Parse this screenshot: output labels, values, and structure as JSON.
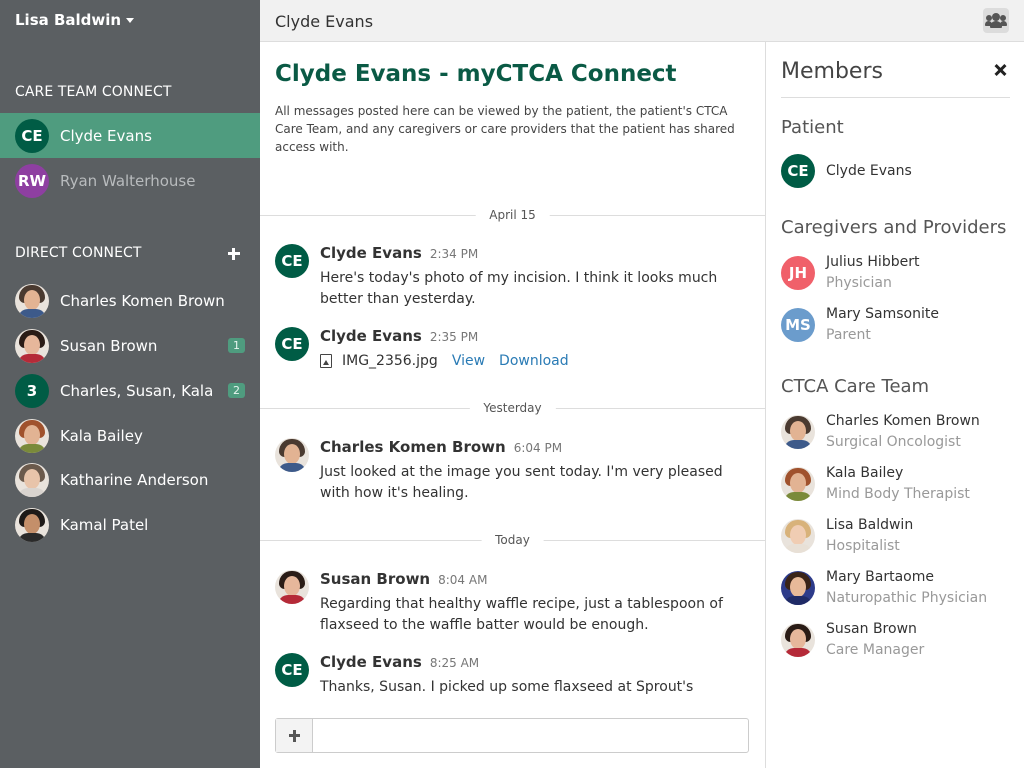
{
  "sidebar": {
    "user_name": "Lisa Baldwin",
    "care_team_header": "CARE TEAM CONNECT",
    "direct_header": "DIRECT CONNECT",
    "care_team": [
      {
        "initials": "CE",
        "label": "Clyde Evans"
      },
      {
        "initials": "RW",
        "label": "Ryan Walterhouse"
      }
    ],
    "direct": [
      {
        "label": "Charles Komen Brown",
        "badge": ""
      },
      {
        "label": "Susan Brown",
        "badge": "1"
      },
      {
        "initials": "3",
        "label": "Charles, Susan, Kala",
        "badge": "2"
      },
      {
        "label": "Kala Bailey",
        "badge": ""
      },
      {
        "label": "Katharine Anderson",
        "badge": ""
      },
      {
        "label": "Kamal Patel",
        "badge": ""
      }
    ]
  },
  "topbar": {
    "title": "Clyde Evans",
    "members_icon": "users-icon"
  },
  "chat": {
    "title": "Clyde Evans - myCTCA Connect",
    "description": "All messages posted here can be viewed by the patient, the patient's CTCA Care Team, and any caregivers or care providers that the patient has shared access with.",
    "dividers": [
      "April 15",
      "Yesterday",
      "Today"
    ],
    "messages": [
      {
        "initials": "CE",
        "name": "Clyde Evans",
        "time": "2:34 PM",
        "text": "Here's today's photo of my incision. I think it looks much better than yesterday."
      },
      {
        "initials": "CE",
        "name": "Clyde Evans",
        "time": "2:35 PM",
        "file": "IMG_2356.jpg",
        "view": "View",
        "download": "Download"
      },
      {
        "name": "Charles Komen Brown",
        "time": "6:04 PM",
        "text": "Just looked at the image you sent today. I'm very pleased with how it's healing."
      },
      {
        "name": "Susan Brown",
        "time": "8:04 AM",
        "text": "Regarding that healthy waffle recipe, just a tablespoon of flaxseed to the waffle batter would be enough."
      },
      {
        "initials": "CE",
        "name": "Clyde Evans",
        "time": "8:25 AM",
        "text": "Thanks, Susan. I picked up some flaxseed at Sprout's"
      }
    ],
    "composer_placeholder": ""
  },
  "members": {
    "title": "Members",
    "groups": [
      {
        "title": "Patient",
        "people": [
          {
            "initials": "CE",
            "name": "Clyde Evans",
            "role": ""
          }
        ]
      },
      {
        "title": "Caregivers and Providers",
        "people": [
          {
            "initials": "JH",
            "name": "Julius Hibbert",
            "role": "Physician"
          },
          {
            "initials": "MS",
            "name": "Mary Samsonite",
            "role": "Parent"
          }
        ]
      },
      {
        "title": "CTCA Care Team",
        "people": [
          {
            "name": "Charles Komen Brown",
            "role": "Surgical Oncologist"
          },
          {
            "name": "Kala Bailey",
            "role": "Mind Body Therapist"
          },
          {
            "name": "Lisa Baldwin",
            "role": "Hospitalist"
          },
          {
            "name": "Mary Bartaome",
            "role": "Naturopathic Physician"
          },
          {
            "name": "Susan Brown",
            "role": "Care Manager"
          }
        ]
      }
    ]
  },
  "colors": {
    "sidebar_bg": "#5b5f62",
    "active_item": "#4f9c7f",
    "brand_green": "#005c45",
    "link_blue": "#2a7bb5"
  }
}
